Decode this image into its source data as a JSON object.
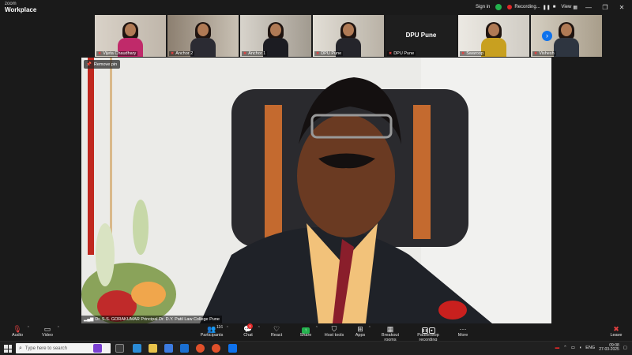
{
  "app": {
    "logo_line1": "zoom",
    "logo_line2": "Workplace"
  },
  "titlebar": {
    "sign_in": "Sign in",
    "recording": "Recording...",
    "view": "View",
    "minimize": "—",
    "maximize": "❐",
    "close": "✕"
  },
  "thumbnails": [
    {
      "name": "Vijeta Chaudhary",
      "muted": true
    },
    {
      "name": "Anchor 2",
      "muted": true
    },
    {
      "name": "Anchor 1",
      "muted": true
    },
    {
      "name": "DPU Pune",
      "muted": true,
      "video_off": true
    },
    {
      "name": "Swaroop",
      "muted": true
    },
    {
      "name": "Vishesh",
      "muted": true
    }
  ],
  "main": {
    "remove_pin": "Remove pin",
    "speaker_name": "Dr. S.S. GORAKUMAR Principal Dr. D.Y. Patil Law College Pune"
  },
  "controls": {
    "audio": "Audio",
    "video": "Video",
    "participants": "Participants",
    "participants_count": "116",
    "chat": "Chat",
    "chat_badge": "1",
    "react": "React",
    "share": "Share",
    "host_tools": "Host tools",
    "apps": "Apps",
    "breakout_rooms": "Breakout rooms",
    "pause_stop_recording": "Pause/stop recording",
    "more": "More",
    "leave": "Leave"
  },
  "taskbar": {
    "search_placeholder": "Type here to search",
    "language": "ENG",
    "time": "09:08",
    "date": "27-03-2025"
  },
  "colors": {
    "zoom_blue": "#0e72ed",
    "recording_red": "#e02828",
    "share_green": "#23b14d",
    "bar_bg": "#1a1a1a"
  }
}
